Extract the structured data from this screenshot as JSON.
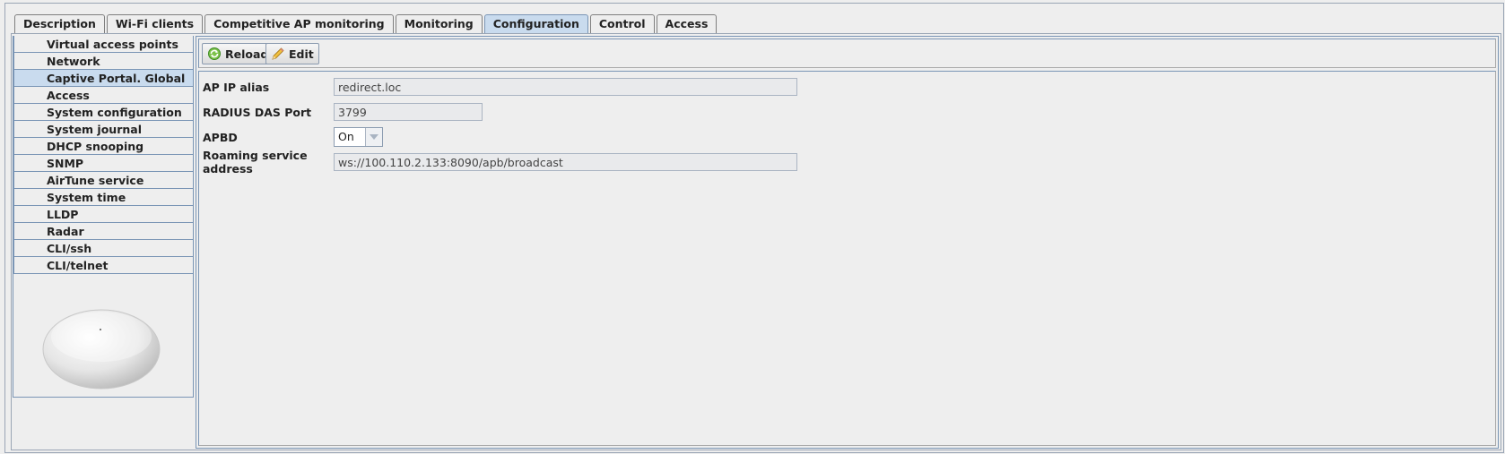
{
  "tabs": [
    {
      "label": "Description"
    },
    {
      "label": "Wi-Fi clients"
    },
    {
      "label": "Competitive AP monitoring"
    },
    {
      "label": "Monitoring"
    },
    {
      "label": "Configuration"
    },
    {
      "label": "Control"
    },
    {
      "label": "Access"
    }
  ],
  "active_tab": "Configuration",
  "sidebar": {
    "items": [
      {
        "label": "Virtual access points"
      },
      {
        "label": "Network"
      },
      {
        "label": "Captive Portal. Global"
      },
      {
        "label": "Access"
      },
      {
        "label": "System configuration"
      },
      {
        "label": "System journal"
      },
      {
        "label": "DHCP snooping"
      },
      {
        "label": "SNMP"
      },
      {
        "label": "AirTune service"
      },
      {
        "label": "System time"
      },
      {
        "label": "LLDP"
      },
      {
        "label": "Radar"
      },
      {
        "label": "CLI/ssh"
      },
      {
        "label": "CLI/telnet"
      }
    ],
    "selected": "Captive Portal. Global"
  },
  "toolbar": {
    "reload_label": "Reload",
    "edit_label": "Edit"
  },
  "form": {
    "ap_ip_alias": {
      "label": "AP IP alias",
      "value": "redirect.loc"
    },
    "radius_das_port": {
      "label": "RADIUS DAS Port",
      "value": "3799"
    },
    "apbd": {
      "label": "APBD",
      "value": "On"
    },
    "roaming_service_address": {
      "label": "Roaming service address",
      "value": "ws://100.110.2.133:8090/apb/broadcast"
    }
  },
  "colors": {
    "accent_selected": "#c9dbee",
    "border": "#7a95b5",
    "background": "#eeeeee"
  },
  "icons": {
    "reload": "refresh-icon",
    "edit": "pencil-icon",
    "device": "access-point-device-image"
  }
}
